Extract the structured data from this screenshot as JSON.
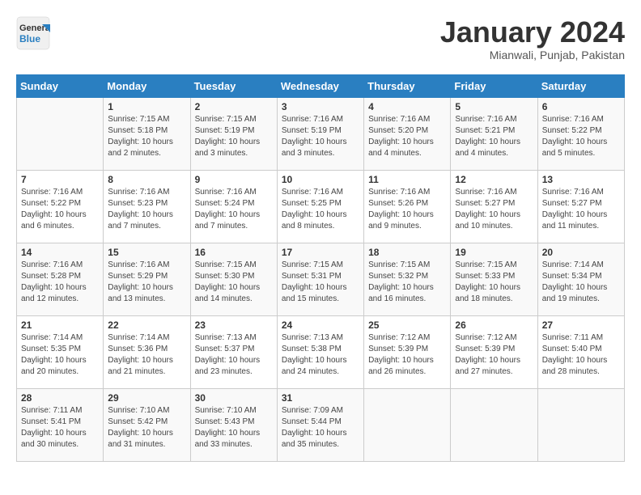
{
  "header": {
    "logo_general": "General",
    "logo_blue": "Blue",
    "month_title": "January 2024",
    "location": "Mianwali, Punjab, Pakistan"
  },
  "days_of_week": [
    "Sunday",
    "Monday",
    "Tuesday",
    "Wednesday",
    "Thursday",
    "Friday",
    "Saturday"
  ],
  "weeks": [
    [
      {
        "day": "",
        "sunrise": "",
        "sunset": "",
        "daylight": ""
      },
      {
        "day": "1",
        "sunrise": "Sunrise: 7:15 AM",
        "sunset": "Sunset: 5:18 PM",
        "daylight": "Daylight: 10 hours and 2 minutes."
      },
      {
        "day": "2",
        "sunrise": "Sunrise: 7:15 AM",
        "sunset": "Sunset: 5:19 PM",
        "daylight": "Daylight: 10 hours and 3 minutes."
      },
      {
        "day": "3",
        "sunrise": "Sunrise: 7:16 AM",
        "sunset": "Sunset: 5:19 PM",
        "daylight": "Daylight: 10 hours and 3 minutes."
      },
      {
        "day": "4",
        "sunrise": "Sunrise: 7:16 AM",
        "sunset": "Sunset: 5:20 PM",
        "daylight": "Daylight: 10 hours and 4 minutes."
      },
      {
        "day": "5",
        "sunrise": "Sunrise: 7:16 AM",
        "sunset": "Sunset: 5:21 PM",
        "daylight": "Daylight: 10 hours and 4 minutes."
      },
      {
        "day": "6",
        "sunrise": "Sunrise: 7:16 AM",
        "sunset": "Sunset: 5:22 PM",
        "daylight": "Daylight: 10 hours and 5 minutes."
      }
    ],
    [
      {
        "day": "7",
        "sunrise": "Sunrise: 7:16 AM",
        "sunset": "Sunset: 5:22 PM",
        "daylight": "Daylight: 10 hours and 6 minutes."
      },
      {
        "day": "8",
        "sunrise": "Sunrise: 7:16 AM",
        "sunset": "Sunset: 5:23 PM",
        "daylight": "Daylight: 10 hours and 7 minutes."
      },
      {
        "day": "9",
        "sunrise": "Sunrise: 7:16 AM",
        "sunset": "Sunset: 5:24 PM",
        "daylight": "Daylight: 10 hours and 7 minutes."
      },
      {
        "day": "10",
        "sunrise": "Sunrise: 7:16 AM",
        "sunset": "Sunset: 5:25 PM",
        "daylight": "Daylight: 10 hours and 8 minutes."
      },
      {
        "day": "11",
        "sunrise": "Sunrise: 7:16 AM",
        "sunset": "Sunset: 5:26 PM",
        "daylight": "Daylight: 10 hours and 9 minutes."
      },
      {
        "day": "12",
        "sunrise": "Sunrise: 7:16 AM",
        "sunset": "Sunset: 5:27 PM",
        "daylight": "Daylight: 10 hours and 10 minutes."
      },
      {
        "day": "13",
        "sunrise": "Sunrise: 7:16 AM",
        "sunset": "Sunset: 5:27 PM",
        "daylight": "Daylight: 10 hours and 11 minutes."
      }
    ],
    [
      {
        "day": "14",
        "sunrise": "Sunrise: 7:16 AM",
        "sunset": "Sunset: 5:28 PM",
        "daylight": "Daylight: 10 hours and 12 minutes."
      },
      {
        "day": "15",
        "sunrise": "Sunrise: 7:16 AM",
        "sunset": "Sunset: 5:29 PM",
        "daylight": "Daylight: 10 hours and 13 minutes."
      },
      {
        "day": "16",
        "sunrise": "Sunrise: 7:15 AM",
        "sunset": "Sunset: 5:30 PM",
        "daylight": "Daylight: 10 hours and 14 minutes."
      },
      {
        "day": "17",
        "sunrise": "Sunrise: 7:15 AM",
        "sunset": "Sunset: 5:31 PM",
        "daylight": "Daylight: 10 hours and 15 minutes."
      },
      {
        "day": "18",
        "sunrise": "Sunrise: 7:15 AM",
        "sunset": "Sunset: 5:32 PM",
        "daylight": "Daylight: 10 hours and 16 minutes."
      },
      {
        "day": "19",
        "sunrise": "Sunrise: 7:15 AM",
        "sunset": "Sunset: 5:33 PM",
        "daylight": "Daylight: 10 hours and 18 minutes."
      },
      {
        "day": "20",
        "sunrise": "Sunrise: 7:14 AM",
        "sunset": "Sunset: 5:34 PM",
        "daylight": "Daylight: 10 hours and 19 minutes."
      }
    ],
    [
      {
        "day": "21",
        "sunrise": "Sunrise: 7:14 AM",
        "sunset": "Sunset: 5:35 PM",
        "daylight": "Daylight: 10 hours and 20 minutes."
      },
      {
        "day": "22",
        "sunrise": "Sunrise: 7:14 AM",
        "sunset": "Sunset: 5:36 PM",
        "daylight": "Daylight: 10 hours and 21 minutes."
      },
      {
        "day": "23",
        "sunrise": "Sunrise: 7:13 AM",
        "sunset": "Sunset: 5:37 PM",
        "daylight": "Daylight: 10 hours and 23 minutes."
      },
      {
        "day": "24",
        "sunrise": "Sunrise: 7:13 AM",
        "sunset": "Sunset: 5:38 PM",
        "daylight": "Daylight: 10 hours and 24 minutes."
      },
      {
        "day": "25",
        "sunrise": "Sunrise: 7:12 AM",
        "sunset": "Sunset: 5:39 PM",
        "daylight": "Daylight: 10 hours and 26 minutes."
      },
      {
        "day": "26",
        "sunrise": "Sunrise: 7:12 AM",
        "sunset": "Sunset: 5:39 PM",
        "daylight": "Daylight: 10 hours and 27 minutes."
      },
      {
        "day": "27",
        "sunrise": "Sunrise: 7:11 AM",
        "sunset": "Sunset: 5:40 PM",
        "daylight": "Daylight: 10 hours and 28 minutes."
      }
    ],
    [
      {
        "day": "28",
        "sunrise": "Sunrise: 7:11 AM",
        "sunset": "Sunset: 5:41 PM",
        "daylight": "Daylight: 10 hours and 30 minutes."
      },
      {
        "day": "29",
        "sunrise": "Sunrise: 7:10 AM",
        "sunset": "Sunset: 5:42 PM",
        "daylight": "Daylight: 10 hours and 31 minutes."
      },
      {
        "day": "30",
        "sunrise": "Sunrise: 7:10 AM",
        "sunset": "Sunset: 5:43 PM",
        "daylight": "Daylight: 10 hours and 33 minutes."
      },
      {
        "day": "31",
        "sunrise": "Sunrise: 7:09 AM",
        "sunset": "Sunset: 5:44 PM",
        "daylight": "Daylight: 10 hours and 35 minutes."
      },
      {
        "day": "",
        "sunrise": "",
        "sunset": "",
        "daylight": ""
      },
      {
        "day": "",
        "sunrise": "",
        "sunset": "",
        "daylight": ""
      },
      {
        "day": "",
        "sunrise": "",
        "sunset": "",
        "daylight": ""
      }
    ]
  ]
}
